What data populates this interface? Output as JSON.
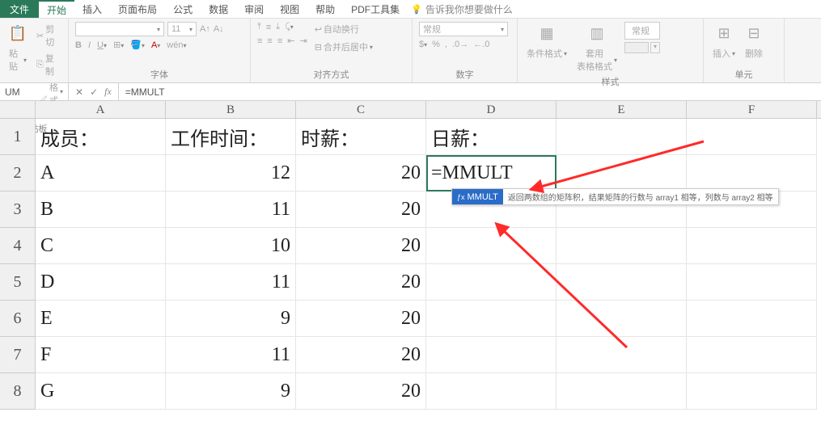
{
  "tabs": {
    "file": "文件",
    "home": "开始",
    "insert": "插入",
    "layout": "页面布局",
    "formulas": "公式",
    "data": "数据",
    "review": "审阅",
    "view": "视图",
    "help": "帮助",
    "pdf": "PDF工具集",
    "tellme": "告诉我你想要做什么"
  },
  "ribbon": {
    "clipboard": {
      "label": "剪贴板",
      "paste": "粘贴",
      "cut": "剪切",
      "copy": "复制",
      "painter": "格式刷"
    },
    "font": {
      "label": "字体",
      "size": "11"
    },
    "align": {
      "label": "对齐方式",
      "wrap": "自动换行",
      "merge": "合并后居中"
    },
    "number": {
      "label": "数字",
      "general": "常规"
    },
    "styles": {
      "label": "样式",
      "cond": "条件格式",
      "table": "套用\n表格格式",
      "general": "常规"
    },
    "cells": {
      "label": "单元"
    },
    "insert_btn": "插入",
    "delete_btn": "删除"
  },
  "formula_bar": {
    "name": "UM",
    "fx": "fx",
    "value": "=MMULT"
  },
  "columns": [
    "A",
    "B",
    "C",
    "D",
    "E",
    "F"
  ],
  "rows": [
    {
      "n": "1",
      "cells": [
        "成员：",
        "工作时间：",
        "时薪：",
        "日薪："
      ]
    },
    {
      "n": "2",
      "cells": [
        "A",
        "12",
        "20",
        "=MMULT"
      ]
    },
    {
      "n": "3",
      "cells": [
        "B",
        "11",
        "20",
        ""
      ]
    },
    {
      "n": "4",
      "cells": [
        "C",
        "10",
        "20",
        ""
      ]
    },
    {
      "n": "5",
      "cells": [
        "D",
        "11",
        "20",
        ""
      ]
    },
    {
      "n": "6",
      "cells": [
        "E",
        "9",
        "20",
        ""
      ]
    },
    {
      "n": "7",
      "cells": [
        "F",
        "11",
        "20",
        ""
      ]
    },
    {
      "n": "8",
      "cells": [
        "G",
        "9",
        "20",
        ""
      ]
    }
  ],
  "tooltip": {
    "name": "MMULT",
    "desc": "返回两数组的矩阵积，结果矩阵的行数与 array1 相等，列数与 array2 相等"
  }
}
